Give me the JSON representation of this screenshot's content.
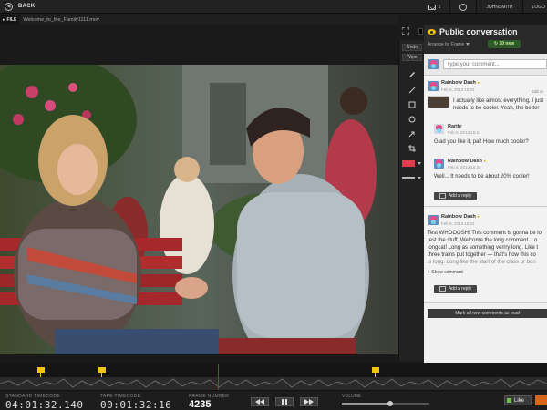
{
  "topbar": {
    "back_label": "BACK",
    "message_count": "1",
    "username": "JOHNSMITH",
    "logout_label": "LOGO"
  },
  "file": {
    "tag": "FILE",
    "name": "Welcome_to_the_Family1111.mov"
  },
  "toolbar": {
    "undo_label": "Undo",
    "wipe_label": "Wipe",
    "tools": [
      "pen-icon",
      "line-icon",
      "rectangle-icon",
      "circle-icon",
      "arrow-icon",
      "crop-icon"
    ],
    "color": "#e03f4f"
  },
  "panel": {
    "title": "Public conversation",
    "arrange_label": "Arrange by Frame",
    "new_badge": "10 new",
    "comment_placeholder": "Type your comment...",
    "mark_read_label": "Mark all new comments as read",
    "show_comment_label": "+ Show comment",
    "reply_label": "Add a reply",
    "threads": [
      {
        "author": "Rainbow Dash",
        "date": "Feb 8, 2013 15:34",
        "edit_label": "Edit or",
        "text": [
          "I actually like almost everything, I just",
          "needs to be cooler. Yeah, the better"
        ],
        "replies": [
          {
            "author": "Rarity",
            "date": "Feb 8, 2013 15:34",
            "text": "Glad you like it, pal! How much cooler?"
          },
          {
            "author": "Rainbow Dash",
            "date": "Feb 8, 2013 15:34",
            "text": "Well... It needs to be about 20% cooler!"
          }
        ]
      },
      {
        "author": "Rainbow Dash",
        "date": "Feb 8, 2013 15:34",
        "text": [
          "Test WHOOOSH! This comment is gonna be lo",
          "test the stuff. Welcome the long comment. Lo",
          "longcat! Long as something verrry long. Like t",
          "three trains put together — that's how this co",
          "is long. Long like the start of the class or bori"
        ]
      }
    ]
  },
  "timeline": {
    "markers": 3
  },
  "bottom": {
    "standard_tc_label": "STANDARD TIMECODE",
    "standard_tc": "04:01:32.140",
    "tape_tc_label": "TAPE TIMECODE",
    "tape_tc": "00:01:32:16",
    "frame_label": "FRAME NUMBER",
    "frame": "4235",
    "volume_label": "VOLUME",
    "volume_level": 0.55,
    "like_label": "Like"
  }
}
